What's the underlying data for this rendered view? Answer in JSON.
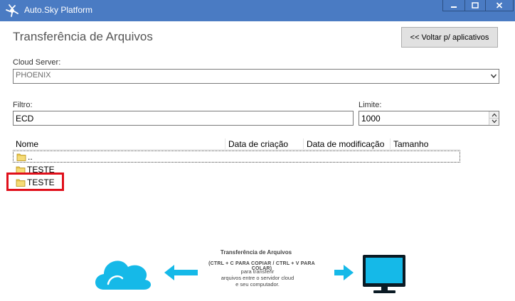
{
  "window": {
    "title": "Auto.Sky Platform",
    "controls": {
      "minimize_icon": "minimize-icon",
      "maximize_icon": "maximize-icon",
      "close_icon": "close-icon"
    }
  },
  "header": {
    "title": "Transferência de Arquivos",
    "back_button": "<< Voltar p/ aplicativos"
  },
  "cloud_server": {
    "label": "Cloud Server:",
    "value": "PHOENIX"
  },
  "filter": {
    "label": "Filtro:",
    "value": "ECD"
  },
  "limit": {
    "label": "Limite:",
    "value": "1000"
  },
  "file_list": {
    "columns": [
      "Nome",
      "Data de criação",
      "Data de modificação",
      "Tamanho"
    ],
    "rows": [
      {
        "name": "..",
        "icon": "folder-icon"
      },
      {
        "name": "TESTE",
        "icon": "folder-icon"
      },
      {
        "name": "TESTE",
        "icon": "folder-icon"
      }
    ]
  },
  "banner": {
    "title": "Transferência de Arquivos",
    "subtitle": "(CTRL + C PARA COPIAR / CTRL + V PARA COLAR)",
    "line1": "para transferir",
    "line2": "arquivos entre o servidor cloud",
    "line3": "e seu computador."
  },
  "colors": {
    "titlebar": "#4a7bc3",
    "highlight": "#e0101b",
    "accent_cyan": "#15b9e8",
    "folder": "#e8c54a"
  }
}
